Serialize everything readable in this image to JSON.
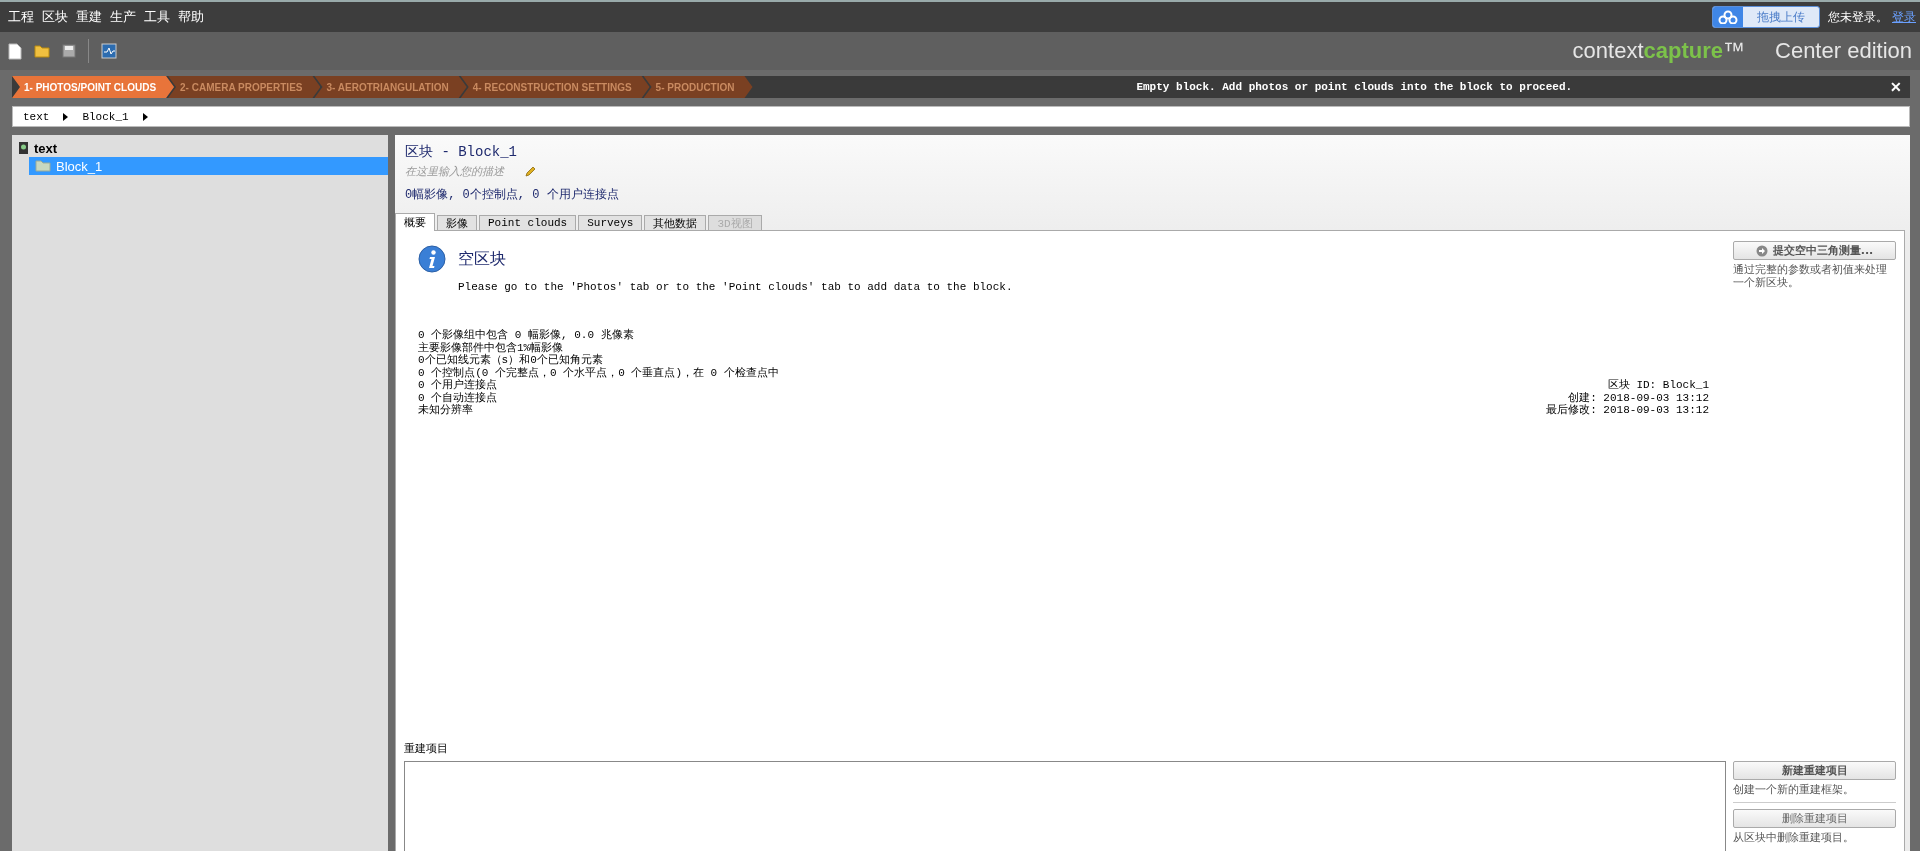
{
  "menu": [
    "工程",
    "区块",
    "重建",
    "生产",
    "工具",
    "帮助"
  ],
  "upload_button": "拖拽上传",
  "login_status": "您未登录。",
  "login_link": "登录",
  "brand": {
    "prefix": "context",
    "highlight": "capture",
    "suffix": "™",
    "edition": "Center edition"
  },
  "steps": [
    {
      "label": "1- PHOTOS/POINT CLOUDS",
      "selected": true
    },
    {
      "label": "2- CAMERA PROPERTIES",
      "selected": false
    },
    {
      "label": "3- AEROTRIANGULATION",
      "selected": false
    },
    {
      "label": "4- RECONSTRUCTION SETTINGS",
      "selected": false
    },
    {
      "label": "5- PRODUCTION",
      "selected": false
    }
  ],
  "notice": "Empty block. Add photos or point clouds into the block to proceed.",
  "notice_close": "✕",
  "breadcrumb": [
    "text",
    "Block_1"
  ],
  "tree": [
    {
      "label": "text",
      "selected": false,
      "children": [
        {
          "label": "Block_1",
          "selected": true
        }
      ]
    }
  ],
  "block": {
    "title": "区块 - Block_1",
    "description": {
      "placeholder": "在这里输入您的描述"
    },
    "summary": "0幅影像, 0个控制点, 0 个用户连接点"
  },
  "tabs": [
    {
      "label": "概要",
      "selected": true,
      "disabled": false
    },
    {
      "label": "影像",
      "selected": false,
      "disabled": false
    },
    {
      "label": "Point clouds",
      "selected": false,
      "disabled": false
    },
    {
      "label": "Surveys",
      "selected": false,
      "disabled": false
    },
    {
      "label": "其他数据",
      "selected": false,
      "disabled": false
    },
    {
      "label": "3D视图",
      "selected": false,
      "disabled": true
    }
  ],
  "overview": {
    "heading": "空区块",
    "message": "Please go to the 'Photos' tab or to the 'Point clouds' tab to add data to the block.",
    "stats": [
      "0 个影像组中包含 0 幅影像, 0.0 兆像素",
      "主要影像部件中包含1%幅影像",
      "0个已知线元素（s）和0个已知角元素",
      "0 个控制点(0 个完整点，0 个水平点，0 个垂直点)，在 0 个检查点中",
      "0 个用户连接点",
      "0 个自动连接点",
      "未知分辨率"
    ],
    "info": [
      "区块 ID: Block_1",
      "创建: 2018-09-03 13:12",
      "最后修改: 2018-09-03 13:12"
    ],
    "action": {
      "button": "提交空中三角测量...",
      "description": "通过完整的参数或者初值来处理一个新区块。"
    }
  },
  "reconstructions": {
    "label": "重建项目",
    "actions": [
      {
        "button": "新建重建项目",
        "description": "创建一个新的重建框架。",
        "disabled": false
      },
      {
        "button": "删除重建项目",
        "description": "从区块中删除重建项目。",
        "disabled": true
      }
    ]
  }
}
